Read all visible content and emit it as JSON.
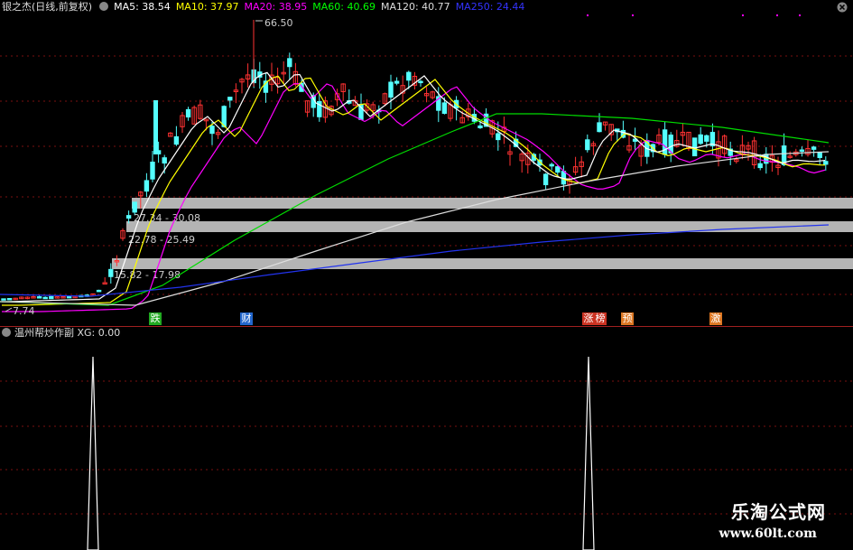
{
  "header": {
    "title": "银之杰(日线,前复权)",
    "ma": [
      {
        "label": "MA5: 38.54",
        "color": "#ffffff"
      },
      {
        "label": "MA10: 37.97",
        "color": "#ffff00"
      },
      {
        "label": "MA20: 38.95",
        "color": "#ff00ff"
      },
      {
        "label": "MA60: 40.69",
        "color": "#00ff00"
      },
      {
        "label": "MA120: 40.77",
        "color": "#dddddd"
      },
      {
        "label": "MA250: 24.44",
        "color": "#3333ff"
      }
    ]
  },
  "main_chart": {
    "high_label": "66.50",
    "low_label": "7.74",
    "price_bands": [
      "27.34 - 30.08",
      "22.78 - 25.49",
      "15.82 - 17.98"
    ],
    "events": [
      {
        "text": "跌",
        "bg": "#22aa22",
        "color": "#ffffff"
      },
      {
        "text": "财",
        "bg": "#2266cc",
        "color": "#ffffff"
      },
      {
        "text": "涨",
        "bg": "#cc3322",
        "color": "#ffffff"
      },
      {
        "text": "榜",
        "bg": "#cc3322",
        "color": "#ffffff"
      },
      {
        "text": "预",
        "bg": "#dd7722",
        "color": "#ffffff"
      },
      {
        "text": "激",
        "bg": "#dd7722",
        "color": "#ffffff"
      }
    ],
    "colors": {
      "up": "#ff3232",
      "down": "#54ffff",
      "grid": "#7a1010",
      "band": "#b4b4b4"
    }
  },
  "indicator": {
    "title": "温州帮炒作副",
    "value_label": "XG: 0.00"
  },
  "watermark": {
    "line1": "乐淘公式网",
    "line2": "www.60lt.com"
  }
}
